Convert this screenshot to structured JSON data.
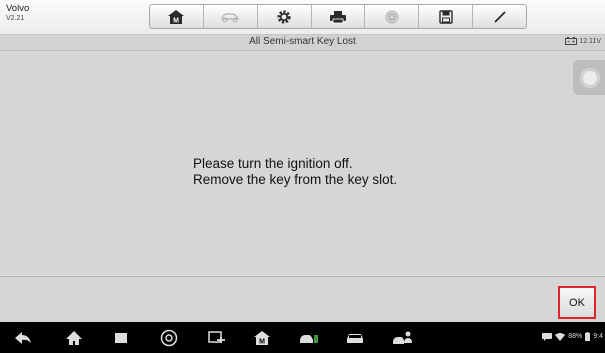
{
  "app": {
    "brand": "Volvo",
    "version": "V2.21"
  },
  "toolbar": {
    "buttons": [
      {
        "icon": "home-icon",
        "enabled": true
      },
      {
        "icon": "vehicle-swap-icon",
        "enabled": false
      },
      {
        "icon": "settings-gear-icon",
        "enabled": true
      },
      {
        "icon": "print-icon",
        "enabled": true
      },
      {
        "icon": "help-icon",
        "enabled": false
      },
      {
        "icon": "save-icon",
        "enabled": true
      },
      {
        "icon": "data-logging-pen-icon",
        "enabled": true
      }
    ]
  },
  "header": {
    "title": "All Semi-smart Key Lost",
    "voltage": "12.11V"
  },
  "message": {
    "line1": "Please turn the ignition off.",
    "line2": "Remove the key from the key slot."
  },
  "actions": {
    "ok_label": "OK",
    "ok_highlight_color": "#e0242b"
  },
  "system_bar": {
    "battery": "88%",
    "time": "9:4"
  }
}
